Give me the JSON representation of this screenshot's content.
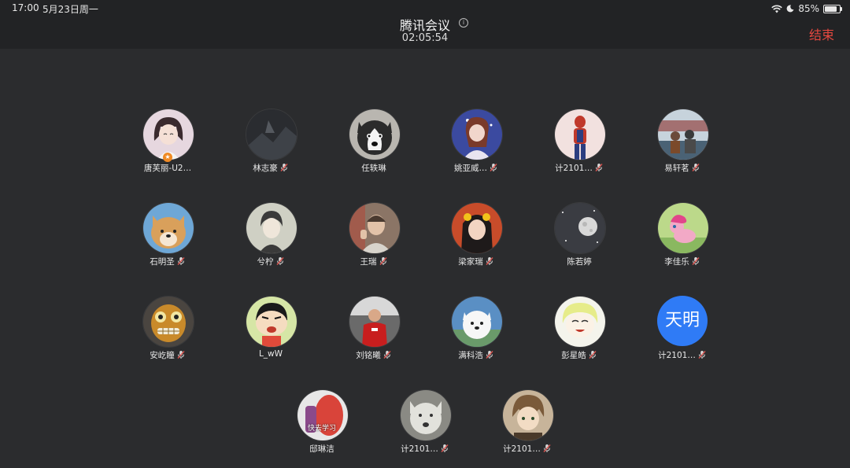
{
  "status_bar": {
    "time": "17:00",
    "date": "5月23日周一",
    "battery": "85%",
    "battery_level": 0.85
  },
  "header": {
    "title": "腾讯会议",
    "timer": "02:05:54",
    "end_label": "结束"
  },
  "colors": {
    "background": "#2b2c2e",
    "header": "#222325",
    "end": "#e5483f",
    "mic_muted": "#d9534f",
    "text_avatar": "#2f7bf6"
  },
  "participants": [
    {
      "name": "唐芙丽-U2…",
      "muted": false,
      "host": true,
      "avatar": "anime-girl"
    },
    {
      "name": "林志豪",
      "muted": true,
      "avatar": "dark-scene"
    },
    {
      "name": "任轶琳",
      "muted": false,
      "avatar": "husky"
    },
    {
      "name": "姚亚威…",
      "muted": true,
      "avatar": "anime-character"
    },
    {
      "name": "计2101…",
      "muted": true,
      "avatar": "spiderman"
    },
    {
      "name": "易轩茗",
      "muted": true,
      "avatar": "couple-landscape"
    },
    {
      "name": "石明圣",
      "muted": true,
      "avatar": "shiba"
    },
    {
      "name": "兮柠",
      "muted": true,
      "avatar": "sketch-portrait"
    },
    {
      "name": "王瑞",
      "muted": true,
      "avatar": "person-photo"
    },
    {
      "name": "梁家瑞",
      "muted": true,
      "avatar": "girl-photo"
    },
    {
      "name": "陈若婷",
      "muted": false,
      "avatar": "moon"
    },
    {
      "name": "李佳乐",
      "muted": true,
      "avatar": "pink-pony"
    },
    {
      "name": "安屹瞳",
      "muted": true,
      "avatar": "orange-monster"
    },
    {
      "name": "L_wW",
      "muted": false,
      "avatar": "cartoon-boy"
    },
    {
      "name": "刘铭曦",
      "muted": true,
      "avatar": "footballer"
    },
    {
      "name": "满科浩",
      "muted": true,
      "avatar": "samoyed"
    },
    {
      "name": "彭星皓",
      "muted": true,
      "avatar": "smiling-cartoon"
    },
    {
      "name": "计2101…",
      "muted": true,
      "avatar": "text",
      "avatar_text": "天明"
    },
    {
      "name": "邸琳洁",
      "muted": false,
      "avatar": "red-creature",
      "avatar_caption": "快去学习"
    },
    {
      "name": "计2101…",
      "muted": true,
      "avatar": "wolf"
    },
    {
      "name": "计2101…",
      "muted": true,
      "avatar": "anime-boy"
    }
  ]
}
